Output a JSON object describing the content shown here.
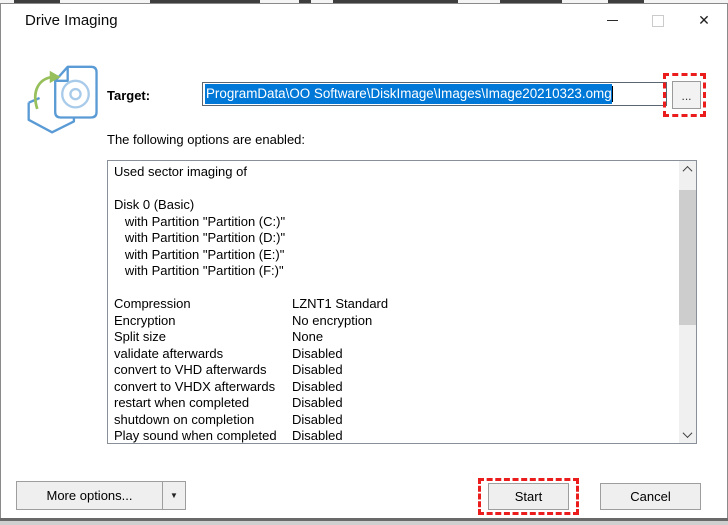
{
  "window": {
    "title": "Drive Imaging",
    "controls": {
      "minimize": "minimize",
      "maximize": "maximize (disabled)",
      "close": "✕"
    }
  },
  "target": {
    "label": "Target:",
    "value": "ProgramData\\OO Software\\DiskImage\\Images\\Image20210323.omg",
    "browse_label": "...",
    "selection_state": "text fully selected"
  },
  "options": {
    "heading": "The following options are enabled:",
    "entries": [
      {
        "text": "Used sector imaging of"
      },
      {
        "text": ""
      },
      {
        "text": "Disk 0 (Basic)"
      },
      {
        "text": "   with Partition \"Partition (C:)\""
      },
      {
        "text": "   with Partition \"Partition (D:)\""
      },
      {
        "text": "   with Partition \"Partition (E:)\""
      },
      {
        "text": "   with Partition \"Partition (F:)\""
      },
      {
        "text": ""
      },
      {
        "key": "Compression",
        "value": "LZNT1 Standard"
      },
      {
        "key": "Encryption",
        "value": "No encryption"
      },
      {
        "key": "Split size",
        "value": "None"
      },
      {
        "key": "validate afterwards",
        "value": "Disabled"
      },
      {
        "key": "convert to VHD afterwards",
        "value": "Disabled"
      },
      {
        "key": "convert to VHDX afterwards",
        "value": "Disabled"
      },
      {
        "key": "restart when completed",
        "value": "Disabled"
      },
      {
        "key": "shutdown on completion",
        "value": "Disabled"
      },
      {
        "key": "Play sound when completed",
        "value": "Disabled"
      }
    ]
  },
  "footer": {
    "more_options_label": "More options...",
    "dropdown_glyph": "▼",
    "start_label": "Start",
    "cancel_label": "Cancel"
  },
  "colors": {
    "selection_blue": "#0078d7",
    "annotation_red": "#ea1c1c",
    "icon_blue": "#5b9bd5",
    "icon_light_blue": "#a9cbea",
    "icon_green": "#97c05c",
    "button_face": "#efefef",
    "scroll_thumb": "#cdcdcd"
  }
}
